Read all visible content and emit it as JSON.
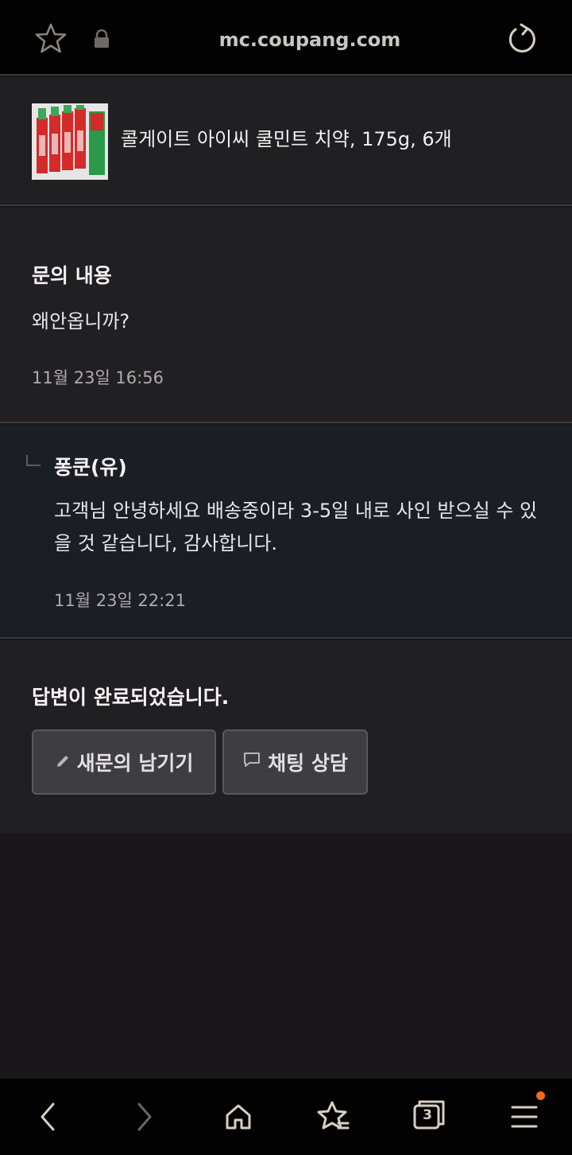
{
  "browser": {
    "url": "mc.coupang.com",
    "icons": {
      "bookmark": "star-icon",
      "secure": "lock-icon",
      "reload": "reload-icon"
    }
  },
  "product": {
    "name": "콜게이트 아이씨 쿨민트 치약, 175g, 6개"
  },
  "inquiry": {
    "heading": "문의 내용",
    "text": "왜안옵니까?",
    "time": "11월 23일 16:56"
  },
  "reply": {
    "author": "퐁쿤(유)",
    "text": "고객님 안녕하세요 배송중이라 3-5일 내로 사인 받으실 수 있을 것 같습니다, 감사합니다.",
    "time": "11월 23일 22:21"
  },
  "status": {
    "message": "답변이 완료되었습니다.",
    "new_inquiry_label": "새문의 남기기",
    "chat_label": "채팅 상담"
  },
  "bottom_nav": {
    "tab_count": "3",
    "items": [
      "back-icon",
      "forward-icon",
      "home-icon",
      "bookmarks-icon",
      "tabs-icon",
      "menu-icon"
    ]
  },
  "colors": {
    "accent_dot": "#f06a1c",
    "icon": "#d8cfc3"
  }
}
